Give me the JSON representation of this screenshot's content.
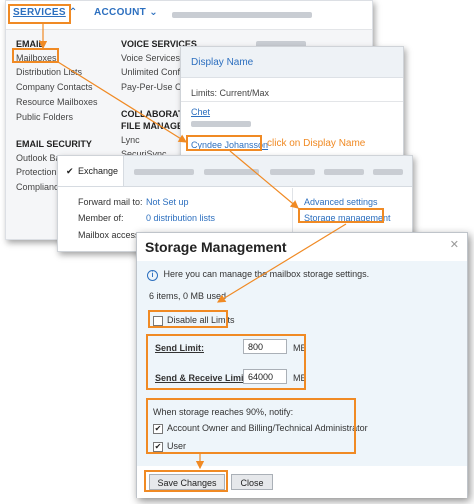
{
  "nav": {
    "services": "SERVICES",
    "account": "ACCOUNT"
  },
  "menu": {
    "email": {
      "heading": "EMAIL",
      "items": [
        "Mailboxes",
        "Distribution Lists",
        "Company Contacts",
        "Resource Mailboxes",
        "Public Folders"
      ]
    },
    "voice": {
      "heading": "VOICE SERVICES",
      "items": [
        "Voice Services",
        "Unlimited Conf",
        "Pay-Per-Use C"
      ]
    },
    "collab": {
      "heading_1": "COLLABORATI",
      "heading_2": "FILE MANAGEM",
      "items": [
        "Lync",
        "SecuriSync"
      ]
    },
    "security": {
      "heading": "EMAIL SECURITY",
      "items": [
        "Outlook Ba",
        "Protection",
        "Complianc"
      ]
    }
  },
  "list_panel": {
    "column": "Display Name",
    "limits": "Limits: Current/Max",
    "rows": [
      "Chet",
      "Cyndee Johansson"
    ]
  },
  "annotation": "click on Display Name",
  "exchange": {
    "tab": "Exchange",
    "forward_label": "Forward mail to:",
    "forward_value": "Not Set up",
    "member_label": "Member of:",
    "member_value": "0 distribution lists",
    "mailbox_label": "Mailbox access:",
    "advanced": "Advanced settings",
    "storage": "Storage management"
  },
  "dialog": {
    "title": "Storage Management",
    "info": "Here you can manage the mailbox storage settings.",
    "usage": "6 items, 0 MB used",
    "disable_label": "Disable all Limits",
    "send_limit_label": "Send Limit:",
    "send_limit_value": "800",
    "send_receive_label": "Send & Receive Limit:",
    "send_receive_value": "64000",
    "unit": "MB",
    "notify_heading": "When storage reaches 90%, notify:",
    "notify_options": [
      "Account Owner and Billing/Technical Administrator",
      "User"
    ],
    "save": "Save Changes",
    "close": "Close"
  },
  "colors": {
    "highlight": "#f08a24",
    "link": "#2c6fbf"
  },
  "icons": [
    "chevron-up-icon",
    "chevron-down-icon",
    "check-icon",
    "info-icon",
    "close-icon"
  ]
}
